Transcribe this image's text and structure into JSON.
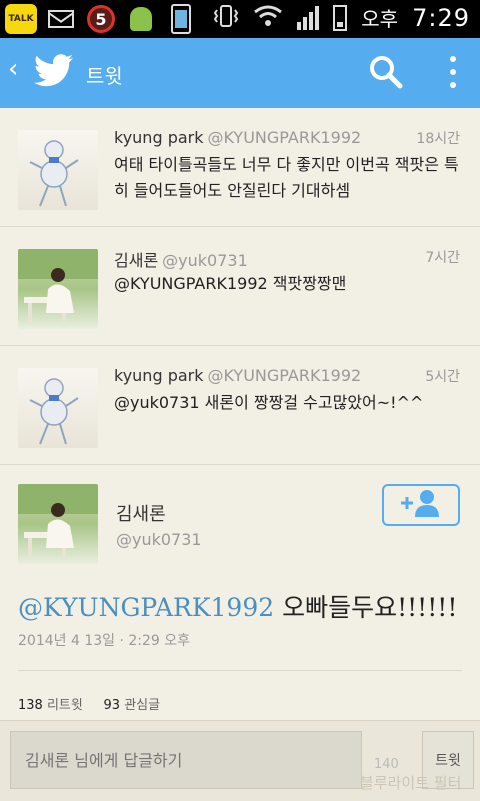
{
  "status_bar": {
    "talk_label": "TALK",
    "notification_count": "5",
    "ampm": "오후",
    "time": "7:29"
  },
  "header": {
    "title": "트윗"
  },
  "timeline": [
    {
      "name": "kyung park",
      "handle": "@KYUNGPARK1992",
      "time": "18시간",
      "text": "여태 타이틀곡들도 너무 다 좋지만 이번곡 잭팟은 특히 들어도들어도 안질린다 기대하셈"
    },
    {
      "name": "김새론",
      "handle": "@yuk0731",
      "time": "7시간",
      "text": "@KYUNGPARK1992 잭팟짱짱맨"
    },
    {
      "name": "kyung park",
      "handle": "@KYUNGPARK1992",
      "time": "5시간",
      "text": "@yuk0731 새론이 짱짱걸 수고많았어~!^^"
    }
  ],
  "detail": {
    "name": "김새론",
    "handle": "@yuk0731",
    "mention": "@KYUNGPARK1992",
    "text_rest": " 오빠들두요!!!!!!",
    "date": "2014년 4 13일 · 2:29 오후",
    "retweets_count": "138",
    "retweets_label": "리트윗",
    "favorites_count": "93",
    "favorites_label": "관심글"
  },
  "reply": {
    "placeholder": "김새론 님에게 답글하기",
    "char_count": "140",
    "tweet_button": "트윗"
  },
  "watermark": "블루라이트 필터",
  "colors": {
    "header": "#55acee",
    "background": "#f2efe4",
    "mention": "#4a8fbf"
  }
}
